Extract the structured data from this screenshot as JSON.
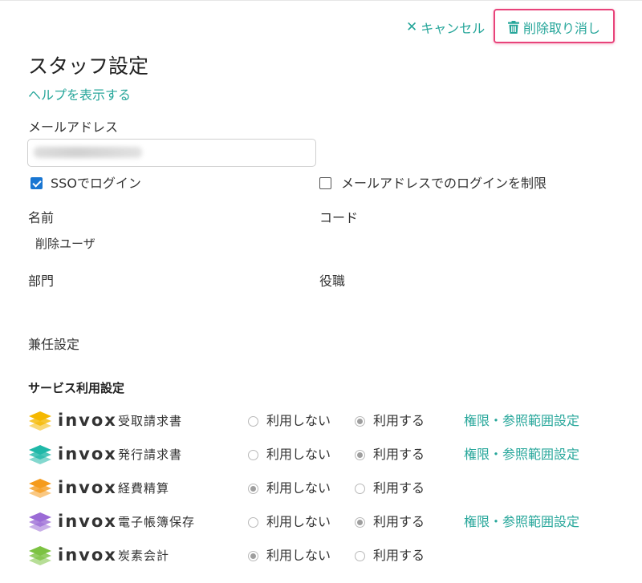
{
  "header": {
    "cancel_label": "キャンセル",
    "undo_delete_label": "削除取り消し"
  },
  "page_title": "スタッフ設定",
  "help_link": "ヘルプを表示する",
  "email": {
    "label": "メールアドレス"
  },
  "sso_login": {
    "label": "SSOでログイン",
    "checked": true
  },
  "restrict_email_login": {
    "label": "メールアドレスでのログインを制限",
    "checked": false
  },
  "name": {
    "label": "名前",
    "value": "削除ユーザ"
  },
  "code": {
    "label": "コード"
  },
  "department": {
    "label": "部門"
  },
  "position": {
    "label": "役職"
  },
  "concurrent": {
    "label": "兼任設定"
  },
  "services": {
    "title": "サービス利用設定",
    "brand": "invox",
    "option_no": "利用しない",
    "option_yes": "利用する",
    "permission_label": "権限・参照範囲設定",
    "items": [
      {
        "name": "受取請求書",
        "color": "#f5b800",
        "selected": "yes",
        "has_permission": true
      },
      {
        "name": "発行請求書",
        "color": "#1fb8a8",
        "selected": "yes",
        "has_permission": true
      },
      {
        "name": "経費精算",
        "color": "#f59b1c",
        "selected": "no",
        "has_permission": false
      },
      {
        "name": "電子帳簿保存",
        "color": "#9b6bd6",
        "selected": "yes",
        "has_permission": true
      },
      {
        "name": "炭素会計",
        "color": "#7cc242",
        "selected": "no",
        "has_permission": false
      }
    ]
  },
  "colors": {
    "accent": "#26a69a",
    "highlight": "#e8437a",
    "checkbox": "#1976d2"
  }
}
